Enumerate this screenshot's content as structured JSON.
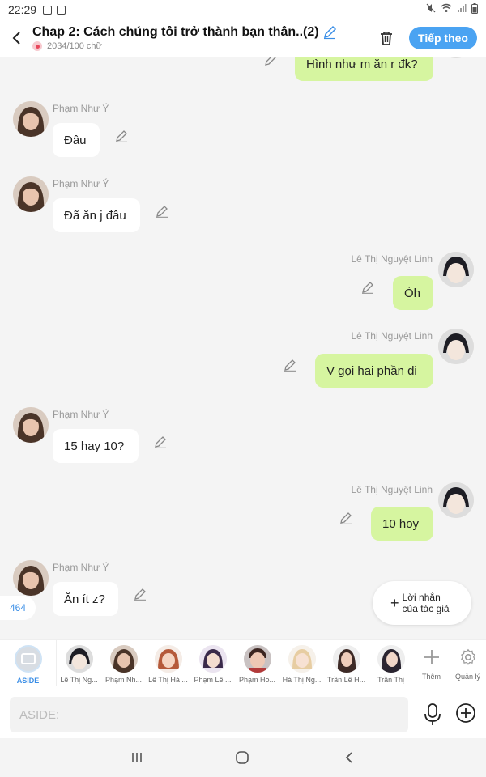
{
  "status_bar": {
    "time": "22:29"
  },
  "header": {
    "title": "Chap 2: Cách chúng tôi trở thành bạn thân..(2)",
    "word_count": "2034/100 chữ",
    "follow_label": "Tiếp theo",
    "accent": "#4aa3f2"
  },
  "messages": [
    {
      "side": "right",
      "sender": "",
      "text": "Hình như m ăn r đk?"
    },
    {
      "side": "left",
      "sender": "Phạm Như Ý",
      "text": "Đâu"
    },
    {
      "side": "left",
      "sender": "Phạm Như Ý",
      "text": "Đã ăn j đâu"
    },
    {
      "side": "right",
      "sender": "Lê Thị Nguyệt Linh",
      "text": "Òh"
    },
    {
      "side": "right",
      "sender": "Lê Thị Nguyệt Linh",
      "text": "V gọi hai phần đi"
    },
    {
      "side": "left",
      "sender": "Phạm Như Ý",
      "text": "15 hay 10?"
    },
    {
      "side": "right",
      "sender": "Lê Thị Nguyệt Linh",
      "text": "10 hoy"
    },
    {
      "side": "left",
      "sender": "Phạm Như Ý",
      "text": "Ăn ít z?"
    }
  ],
  "count_chip": "464",
  "author_note": {
    "line1": "Lời nhắn",
    "line2": "của tác giả"
  },
  "character_bar": {
    "aside_label": "ASIDE",
    "characters": [
      "Lê Thị Ng...",
      "Phạm Nh...",
      "Lê Thị Hà ...",
      "Phạm Lê ...",
      "Phạm Ho...",
      "Hà Thị Ng...",
      "Trần Lê H...",
      "Trần Thị"
    ],
    "add_label": "Thêm",
    "manage_label": "Quản lý"
  },
  "input": {
    "placeholder": "ASIDE:"
  },
  "colors": {
    "right_bubble": "#d6f5a0",
    "left_bubble": "#ffffff",
    "background": "#f4f4f4"
  }
}
